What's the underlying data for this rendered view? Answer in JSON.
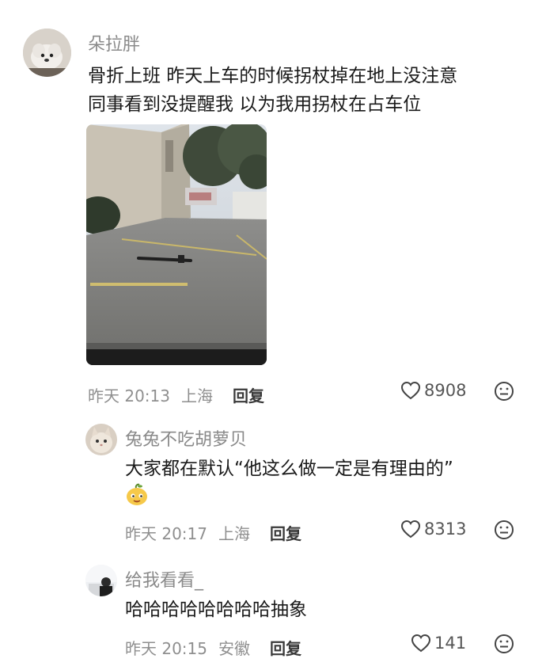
{
  "comments": [
    {
      "user": "朵拉胖",
      "text_lines": [
        "骨折上班 昨天上车的时候拐杖掉在地上没注意",
        "同事看到没提醒我 以为我用拐杖在占车位"
      ],
      "time": "昨天 20:13",
      "location": "上海",
      "reply_label": "回复",
      "likes": "8908"
    },
    {
      "user": "兔兔不吃胡萝贝",
      "text": "大家都在默认“他这么做一定是有理由的”",
      "time": "昨天 20:17",
      "location": "上海",
      "reply_label": "回复",
      "likes": "8313"
    },
    {
      "user": "给我看看_",
      "text": "哈哈哈哈哈哈哈哈抽象",
      "time": "昨天 20:15",
      "location": "安徽",
      "reply_label": "回复",
      "likes": "141"
    }
  ],
  "icons": {
    "like": "heart-outline-icon",
    "reaction": "neutral-face-icon",
    "sticker": "mango-emoji-sticker"
  },
  "colors": {
    "username": "#8a8a8a",
    "meta": "#8f8f8f",
    "text": "#1a1a1a"
  }
}
